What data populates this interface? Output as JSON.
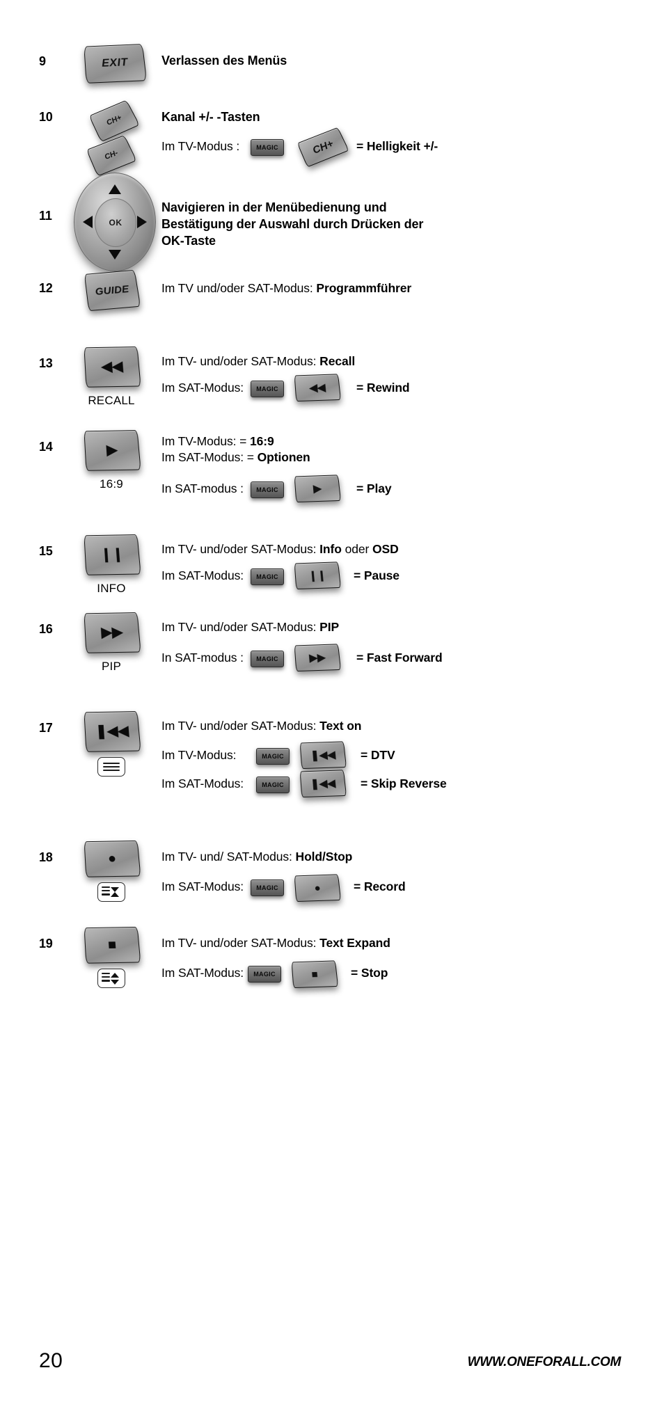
{
  "page": {
    "number": "20",
    "website": "WWW.ONEFORALL.COM"
  },
  "labels": {
    "magic": "MAGIC",
    "ok": "OK"
  },
  "rows": [
    {
      "num": "9",
      "button": {
        "label": "EXIT",
        "caption": ""
      },
      "headline": "Verlassen des Menüs",
      "lines": []
    },
    {
      "num": "10",
      "button": {
        "label_plus": "CH+",
        "label_minus": "CH-",
        "caption": ""
      },
      "headline": "Kanal +/- -Tasten",
      "lines": [
        {
          "prefix": "Im TV-Modus :",
          "magic": "MAGIC",
          "key": "CH+",
          "result": "= Helligkeit +/-"
        }
      ]
    },
    {
      "num": "11",
      "button": {
        "label": "OK",
        "caption": ""
      },
      "headline": "Navigieren in der Menübedienung und Bestätigung der Auswahl durch Drücken der OK-Taste",
      "headline_lines": [
        "Navigieren in der Menübedienung und",
        "Bestätigung der Auswahl durch Drücken der",
        "OK-Taste"
      ],
      "lines": []
    },
    {
      "num": "12",
      "button": {
        "label": "GUIDE",
        "caption": ""
      },
      "text_plain": "Im TV und/oder SAT-Modus: ",
      "text_bold": "Programmführer",
      "lines": []
    },
    {
      "num": "13",
      "button": {
        "glyph": "rewind",
        "caption": "RECALL"
      },
      "text_plain": "Im TV- und/oder SAT-Modus: ",
      "text_bold": "Recall",
      "lines": [
        {
          "prefix": "Im SAT-Modus:",
          "magic": "MAGIC",
          "key": "rewind",
          "result": "= Rewind"
        }
      ]
    },
    {
      "num": "14",
      "button": {
        "glyph": "play",
        "caption": "16:9"
      },
      "text_two": [
        {
          "plain": "Im TV-Modus: = ",
          "bold": "16:9"
        },
        {
          "plain": "Im SAT-Modus: = ",
          "bold": "Optionen"
        }
      ],
      "lines": [
        {
          "prefix": "In SAT-modus :",
          "magic": "MAGIC",
          "key": "play",
          "result": "= Play"
        }
      ]
    },
    {
      "num": "15",
      "button": {
        "glyph": "pause",
        "caption": "INFO"
      },
      "text_plain": "Im TV- und/oder SAT-Modus: ",
      "text_bold": "Info",
      "text_plain2": " oder ",
      "text_bold2": "OSD",
      "lines": [
        {
          "prefix": "Im SAT-Modus:",
          "magic": "MAGIC",
          "key": "pause",
          "result": "= Pause"
        }
      ]
    },
    {
      "num": "16",
      "button": {
        "glyph": "forward",
        "caption": "PIP"
      },
      "text_plain": "Im TV- und/oder SAT-Modus: ",
      "text_bold": "PIP",
      "lines": [
        {
          "prefix": "In SAT-modus :",
          "magic": "MAGIC",
          "key": "forward",
          "result": "= Fast Forward"
        }
      ]
    },
    {
      "num": "17",
      "button": {
        "glyph": "skipback",
        "caption": "",
        "subicon": "teletext-lines"
      },
      "text_plain": "Im TV- und/oder SAT-Modus: ",
      "text_bold": "Text on",
      "lines": [
        {
          "prefix": "Im TV-Modus:",
          "magic": "MAGIC",
          "key": "skipback",
          "result": "= DTV"
        },
        {
          "prefix": "Im SAT-Modus:",
          "magic": "MAGIC",
          "key": "skipback",
          "result": "= Skip Reverse"
        }
      ]
    },
    {
      "num": "18",
      "button": {
        "glyph": "record",
        "caption": "",
        "subicon": "teletext-hold"
      },
      "text_plain": "Im TV- und/ SAT-Modus:  ",
      "text_bold": "Hold/Stop",
      "lines": [
        {
          "prefix": "Im SAT-Modus:",
          "magic": "MAGIC",
          "key": "record",
          "result": "= Record"
        }
      ]
    },
    {
      "num": "19",
      "button": {
        "glyph": "stop",
        "caption": "",
        "subicon": "teletext-expand"
      },
      "text_plain": "Im TV- und/oder SAT-Modus: ",
      "text_bold": "Text Expand",
      "lines": [
        {
          "prefix": "Im SAT-Modus:",
          "magic": "MAGIC",
          "key": "stop",
          "result": "= Stop"
        }
      ]
    }
  ]
}
